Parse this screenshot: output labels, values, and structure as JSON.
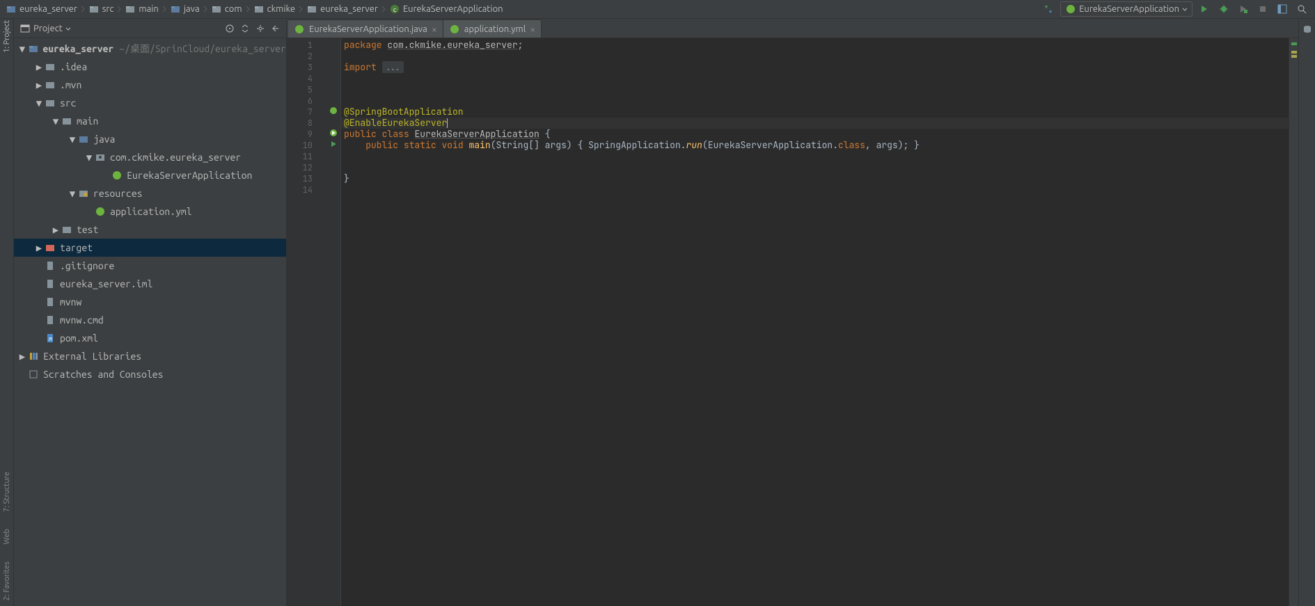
{
  "breadcrumbs": [
    {
      "label": "eureka_server",
      "icon": "folder"
    },
    {
      "label": "src",
      "icon": "folder"
    },
    {
      "label": "main",
      "icon": "folder"
    },
    {
      "label": "java",
      "icon": "package-root"
    },
    {
      "label": "com",
      "icon": "package"
    },
    {
      "label": "ckmike",
      "icon": "package"
    },
    {
      "label": "eureka_server",
      "icon": "package"
    },
    {
      "label": "EurekaServerApplication",
      "icon": "class"
    }
  ],
  "run_config": {
    "label": "EurekaServerApplication"
  },
  "project_panel": {
    "title": "Project"
  },
  "left_tools": {
    "project": "1: Project",
    "structure": "7: Structure",
    "web": "Web",
    "favorites": "2: Favorites"
  },
  "tree": {
    "root": {
      "name": "eureka_server",
      "path": "~/桌面/SprinCloud/eureka_server"
    },
    "idea": ".idea",
    "mvn": ".mvn",
    "src": "src",
    "main": "main",
    "java": "java",
    "pkg": "com.ckmike.eureka_server",
    "appclass": "EurekaServerApplication",
    "resources": "resources",
    "appyml": "application.yml",
    "test": "test",
    "target": "target",
    "gitignore": ".gitignore",
    "iml": "eureka_server.iml",
    "mvnw": "mvnw",
    "mvnwcmd": "mvnw.cmd",
    "pom": "pom.xml",
    "extlib": "External Libraries",
    "scratch": "Scratches and Consoles"
  },
  "tabs": [
    {
      "label": "EurekaServerApplication.java",
      "icon": "class",
      "active": true
    },
    {
      "label": "application.yml",
      "icon": "yaml",
      "active": false
    }
  ],
  "lines": [
    "1",
    "2",
    "3",
    "4",
    "5",
    "6",
    "7",
    "8",
    "9",
    "10",
    "11",
    "12",
    "13",
    "14"
  ],
  "code": {
    "l1_kw": "package",
    "l1_pkg": "com.ckmike.eureka_server",
    "l3_kw": "import",
    "l3_fold": "...",
    "l7": "@SpringBootApplication",
    "l8": "@EnableEurekaServer",
    "l9_public": "public",
    "l9_class": "class",
    "l9_name": "EurekaServerApplication",
    "l10_public": "public",
    "l10_static": "static",
    "l10_void": "void",
    "l10_main": "main",
    "l10_params": "(String[] args) { SpringApplication.",
    "l10_run": "run",
    "l10_tail1": "(EurekaServerApplication.",
    "l10_classkw": "class",
    "l10_tail2": ", args); }"
  }
}
